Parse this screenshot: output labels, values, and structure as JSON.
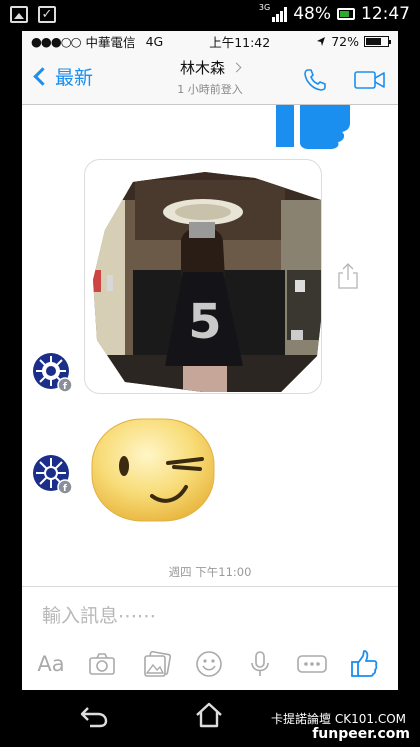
{
  "android_status": {
    "signal_type": "3G",
    "battery": "48%",
    "time": "12:47"
  },
  "ios_status": {
    "carrier": "中華電信",
    "network": "4G",
    "time": "上午11:42",
    "battery": "72%"
  },
  "nav": {
    "back_label": "最新",
    "title": "林木森",
    "subtitle": "1 小時前登入"
  },
  "chat": {
    "timestamp": "週四 下午11:00"
  },
  "composer": {
    "placeholder": "輸入訊息⋯⋯",
    "text_tool_label": "Aa"
  },
  "watermark": {
    "line1": "卡提諾論壇 CK101.COM",
    "line2": "funpeer.com"
  },
  "colors": {
    "accent": "#1a8ff0",
    "avatar_blue": "#1b2f8a",
    "emoji_yellow": "#f6cf54"
  },
  "icons": [
    "picture-icon",
    "checkbox-icon",
    "phone-icon",
    "video-icon",
    "share-icon",
    "camera-icon",
    "image-icon",
    "smile-icon",
    "mic-icon",
    "more-icon",
    "thumbs-up-icon",
    "android-back-icon",
    "android-home-icon"
  ]
}
